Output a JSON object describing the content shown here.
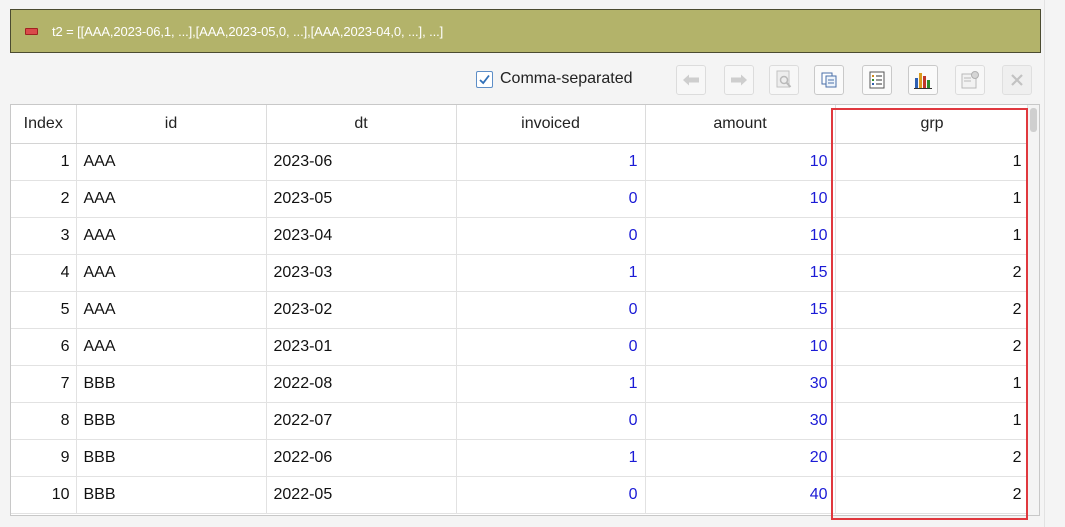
{
  "variable": {
    "expression": "t2 = [[AAA,2023-06,1, ...],[AAA,2023-05,0, ...],[AAA,2023-04,0, ...], ...]"
  },
  "toolbar": {
    "comma_separated_label": "Comma-separated",
    "comma_separated_checked": true,
    "buttons": [
      "back-arrow-icon",
      "forward-arrow-icon",
      "preview-icon",
      "copy-icon",
      "list-icon",
      "chart-icon",
      "properties-icon",
      "close-icon"
    ]
  },
  "table": {
    "columns": [
      "Index",
      "id",
      "dt",
      "invoiced",
      "amount",
      "grp"
    ],
    "rows": [
      {
        "index": "1",
        "id": "AAA",
        "dt": "2023-06",
        "invoiced": "1",
        "amount": "10",
        "grp": "1"
      },
      {
        "index": "2",
        "id": "AAA",
        "dt": "2023-05",
        "invoiced": "0",
        "amount": "10",
        "grp": "1"
      },
      {
        "index": "3",
        "id": "AAA",
        "dt": "2023-04",
        "invoiced": "0",
        "amount": "10",
        "grp": "1"
      },
      {
        "index": "4",
        "id": "AAA",
        "dt": "2023-03",
        "invoiced": "1",
        "amount": "15",
        "grp": "2"
      },
      {
        "index": "5",
        "id": "AAA",
        "dt": "2023-02",
        "invoiced": "0",
        "amount": "15",
        "grp": "2"
      },
      {
        "index": "6",
        "id": "AAA",
        "dt": "2023-01",
        "invoiced": "0",
        "amount": "10",
        "grp": "2"
      },
      {
        "index": "7",
        "id": "BBB",
        "dt": "2022-08",
        "invoiced": "1",
        "amount": "30",
        "grp": "1"
      },
      {
        "index": "8",
        "id": "BBB",
        "dt": "2022-07",
        "invoiced": "0",
        "amount": "30",
        "grp": "1"
      },
      {
        "index": "9",
        "id": "BBB",
        "dt": "2022-06",
        "invoiced": "1",
        "amount": "20",
        "grp": "2"
      },
      {
        "index": "10",
        "id": "BBB",
        "dt": "2022-05",
        "invoiced": "0",
        "amount": "40",
        "grp": "2"
      }
    ]
  },
  "colors": {
    "header_bar": "#b3b36a",
    "numeric_text": "#1b1bd6",
    "highlight": "#e0383e"
  }
}
